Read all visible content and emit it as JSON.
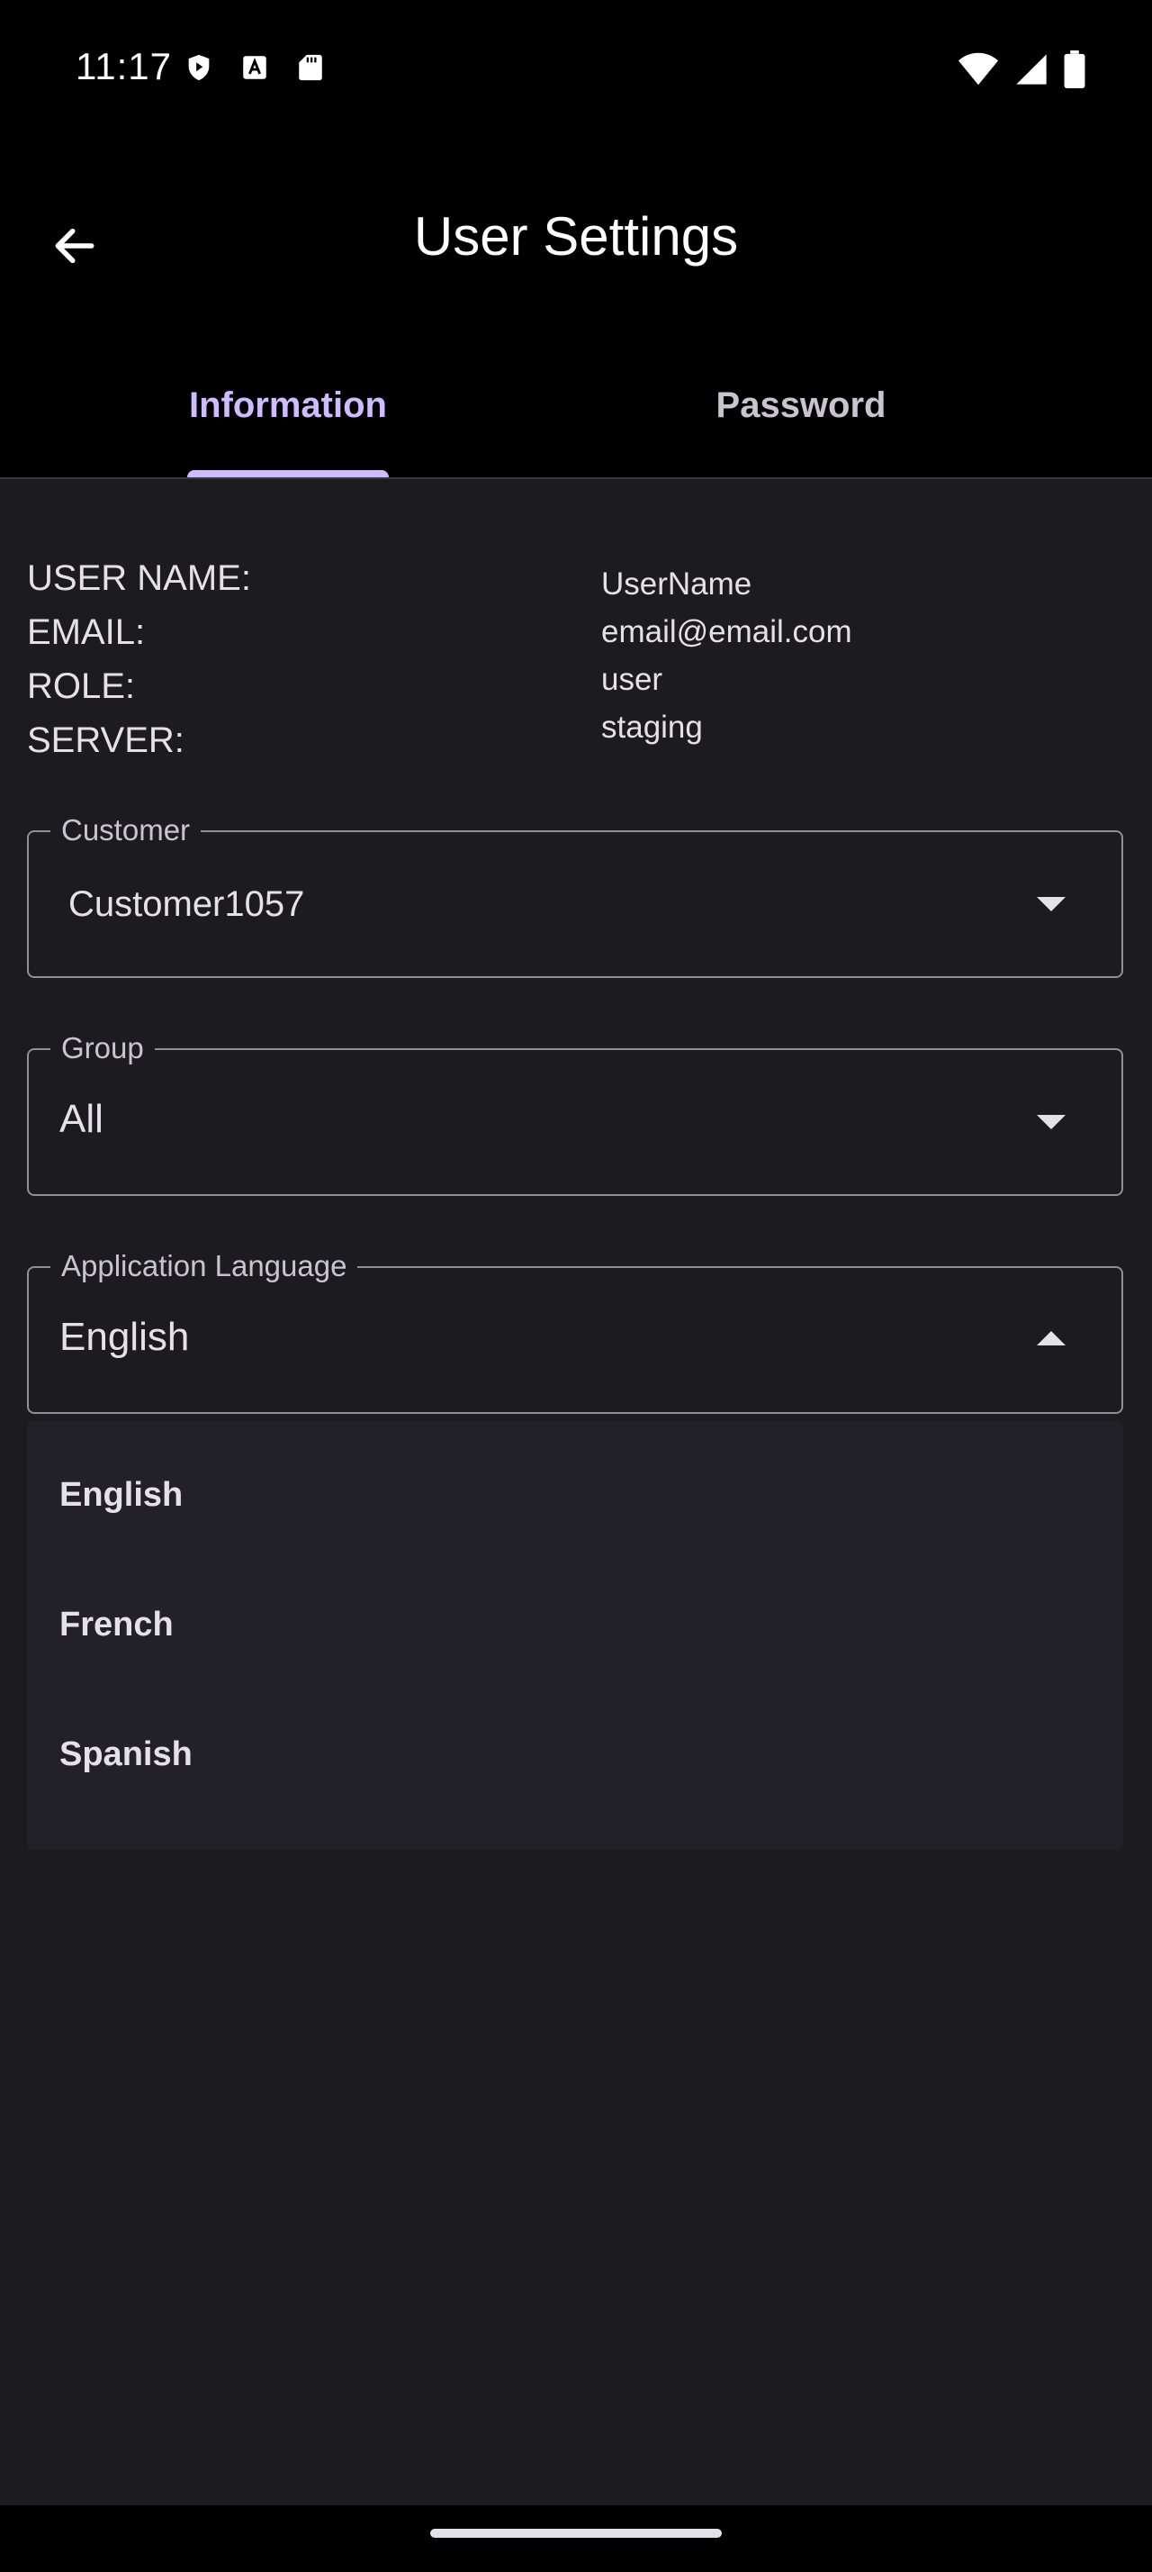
{
  "status_bar": {
    "time": "11:17",
    "left_icons": [
      "shield-icon",
      "font-a-icon",
      "sd-card-icon"
    ],
    "right_icons": [
      "wifi-icon",
      "signal-icon",
      "battery-icon"
    ]
  },
  "app_bar": {
    "title": "User Settings",
    "back_icon": "arrow-left-icon"
  },
  "tabs": [
    {
      "label": "Information",
      "active": true
    },
    {
      "label": "Password",
      "active": false
    }
  ],
  "user_info": {
    "labels": [
      "USER NAME:",
      "EMAIL:",
      "ROLE:",
      "SERVER:"
    ],
    "values": [
      "UserName",
      "email@email.com",
      "user",
      "staging"
    ]
  },
  "fields": {
    "customer": {
      "label": "Customer",
      "value": "Customer1057"
    },
    "group": {
      "label": "Group",
      "value": "All"
    },
    "language": {
      "label": "Application Language",
      "value": "English"
    }
  },
  "language_options": [
    "English",
    "French",
    "Spanish"
  ],
  "colors": {
    "accent": "#cfbcff",
    "background": "#1c1b1f",
    "menu_background": "#222127",
    "outline": "#938f99"
  }
}
